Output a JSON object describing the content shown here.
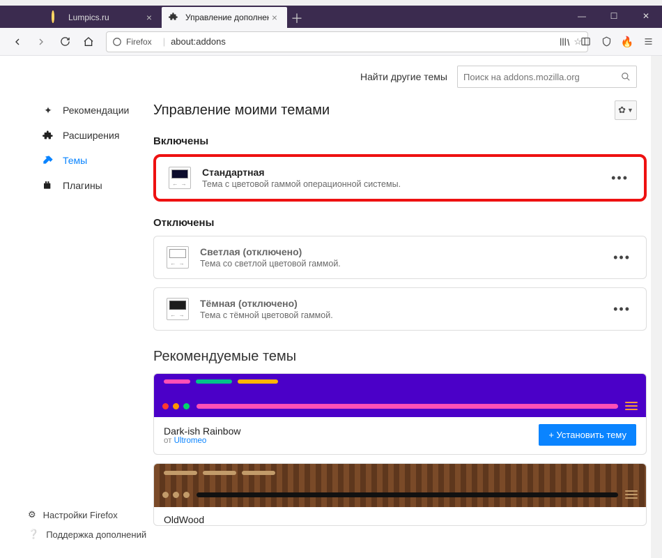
{
  "window": {
    "tabs": [
      {
        "label": "Lumpics.ru"
      },
      {
        "label": "Управление дополнениями"
      }
    ]
  },
  "nav": {
    "identity": "Firefox",
    "url": "about:addons"
  },
  "search": {
    "find_label": "Найти другие темы",
    "placeholder": "Поиск на addons.mozilla.org"
  },
  "header": {
    "title": "Управление моими темами"
  },
  "sidebar": {
    "items": [
      {
        "label": "Рекомендации"
      },
      {
        "label": "Расширения"
      },
      {
        "label": "Темы"
      },
      {
        "label": "Плагины"
      }
    ],
    "footer": {
      "settings": "Настройки Firefox",
      "support": "Поддержка дополнений"
    }
  },
  "sections": {
    "enabled": "Включены",
    "disabled": "Отключены"
  },
  "themes": {
    "standard": {
      "title": "Стандартная",
      "desc": "Тема с цветовой гаммой операционной системы."
    },
    "light": {
      "title": "Светлая (отключено)",
      "desc": "Тема со светлой цветовой гаммой."
    },
    "dark": {
      "title": "Тёмная (отключено)",
      "desc": "Тема с тёмной цветовой гаммой."
    }
  },
  "recommended": {
    "title": "Рекомендуемые темы",
    "install_label": "+ Установить тему",
    "items": [
      {
        "name": "Dark-ish Rainbow",
        "author_prefix": "от ",
        "author": "Ultromeo"
      },
      {
        "name": "OldWood",
        "author_prefix": "",
        "author": ""
      }
    ]
  }
}
